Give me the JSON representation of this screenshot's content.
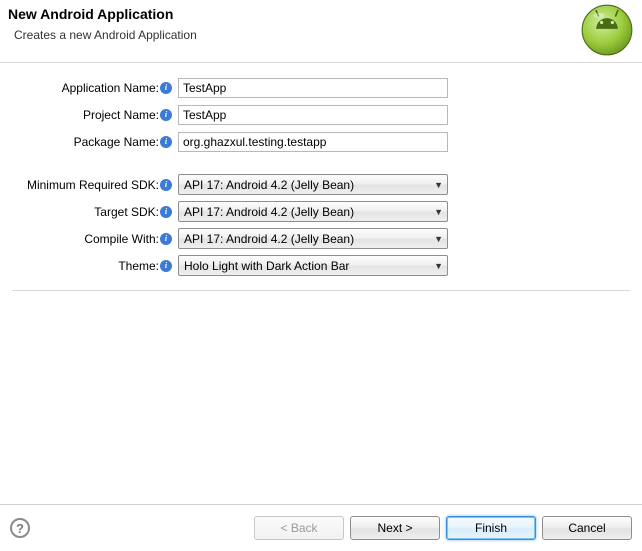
{
  "banner": {
    "title": "New Android Application",
    "subtitle": "Creates a new Android Application"
  },
  "fields": {
    "app_name": {
      "label": "Application Name:",
      "value": "TestApp"
    },
    "project_name": {
      "label": "Project Name:",
      "value": "TestApp"
    },
    "package_name": {
      "label": "Package Name:",
      "value": "org.ghazxul.testing.testapp"
    },
    "min_sdk": {
      "label": "Minimum Required SDK:",
      "value": "API 17: Android 4.2 (Jelly Bean)"
    },
    "target_sdk": {
      "label": "Target SDK:",
      "value": "API 17: Android 4.2 (Jelly Bean)"
    },
    "compile_with": {
      "label": "Compile With:",
      "value": "API 17: Android 4.2 (Jelly Bean)"
    },
    "theme": {
      "label": "Theme:",
      "value": "Holo Light with Dark Action Bar"
    }
  },
  "buttons": {
    "back": "< Back",
    "next": "Next >",
    "finish": "Finish",
    "cancel": "Cancel"
  }
}
